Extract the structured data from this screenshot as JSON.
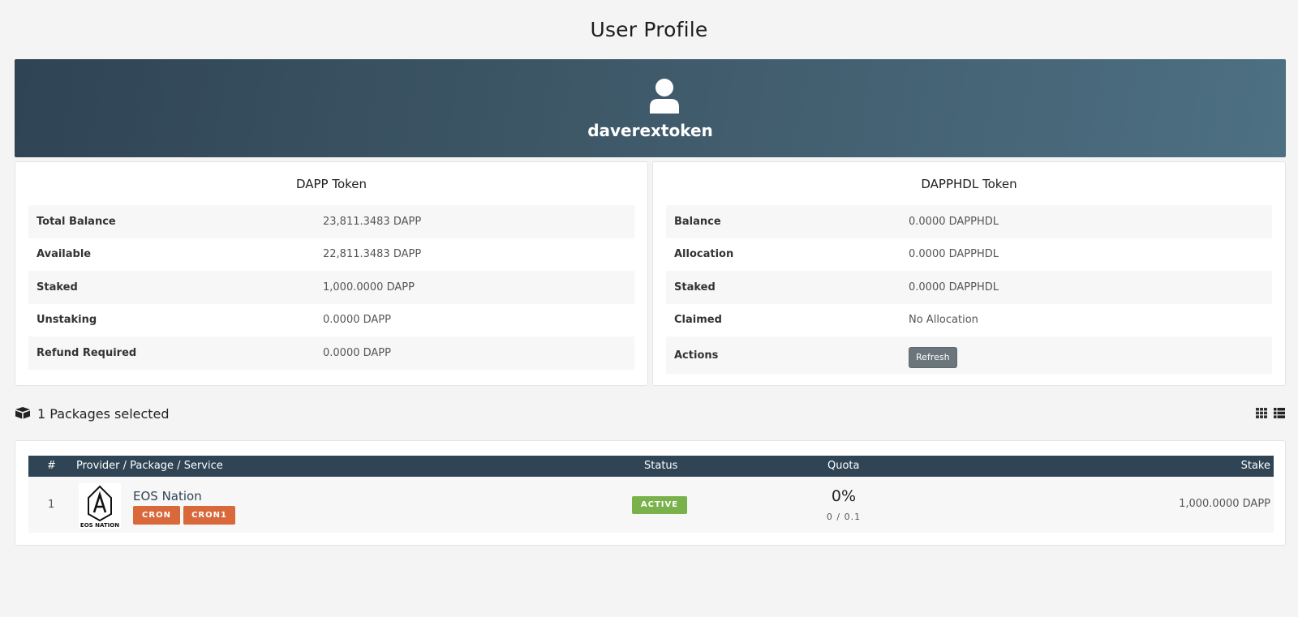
{
  "page": {
    "title": "User Profile"
  },
  "profile": {
    "username": "daverextoken",
    "avatar_icon": "user-icon"
  },
  "dapp_token": {
    "title": "DAPP Token",
    "rows": [
      {
        "label": "Total Balance",
        "value": "23,811.3483 DAPP"
      },
      {
        "label": "Available",
        "value": "22,811.3483 DAPP"
      },
      {
        "label": "Staked",
        "value": "1,000.0000 DAPP"
      },
      {
        "label": "Unstaking",
        "value": "0.0000 DAPP"
      },
      {
        "label": "Refund Required",
        "value": "0.0000 DAPP"
      }
    ]
  },
  "dapphdl_token": {
    "title": "DAPPHDL Token",
    "rows": [
      {
        "label": "Balance",
        "value": "0.0000 DAPPHDL"
      },
      {
        "label": "Allocation",
        "value": "0.0000 DAPPHDL"
      },
      {
        "label": "Staked",
        "value": "0.0000 DAPPHDL"
      },
      {
        "label": "Claimed",
        "value": "No Allocation"
      },
      {
        "label": "Actions",
        "value": ""
      }
    ],
    "refresh_label": "Refresh"
  },
  "packages": {
    "summary": "1 Packages selected",
    "icons": {
      "box": "cubes-icon",
      "grid": "grid-view-icon",
      "list": "list-view-icon"
    },
    "columns": {
      "index": "#",
      "provider": "Provider / Package / Service",
      "status": "Status",
      "quota": "Quota",
      "stake": "Stake"
    },
    "rows": [
      {
        "index": "1",
        "provider": "EOS Nation",
        "logo_text": "EOS NATION",
        "services": [
          "CRON",
          "CRON1"
        ],
        "status": "ACTIVE",
        "quota_percent": "0%",
        "quota_ratio": "0 / 0.1",
        "stake": "1,000.0000 DAPP"
      }
    ]
  },
  "colors": {
    "header_dark": "#2f4454",
    "tag_orange": "#d9683b",
    "status_green": "#79b24a",
    "button_gray": "#6b757c"
  }
}
